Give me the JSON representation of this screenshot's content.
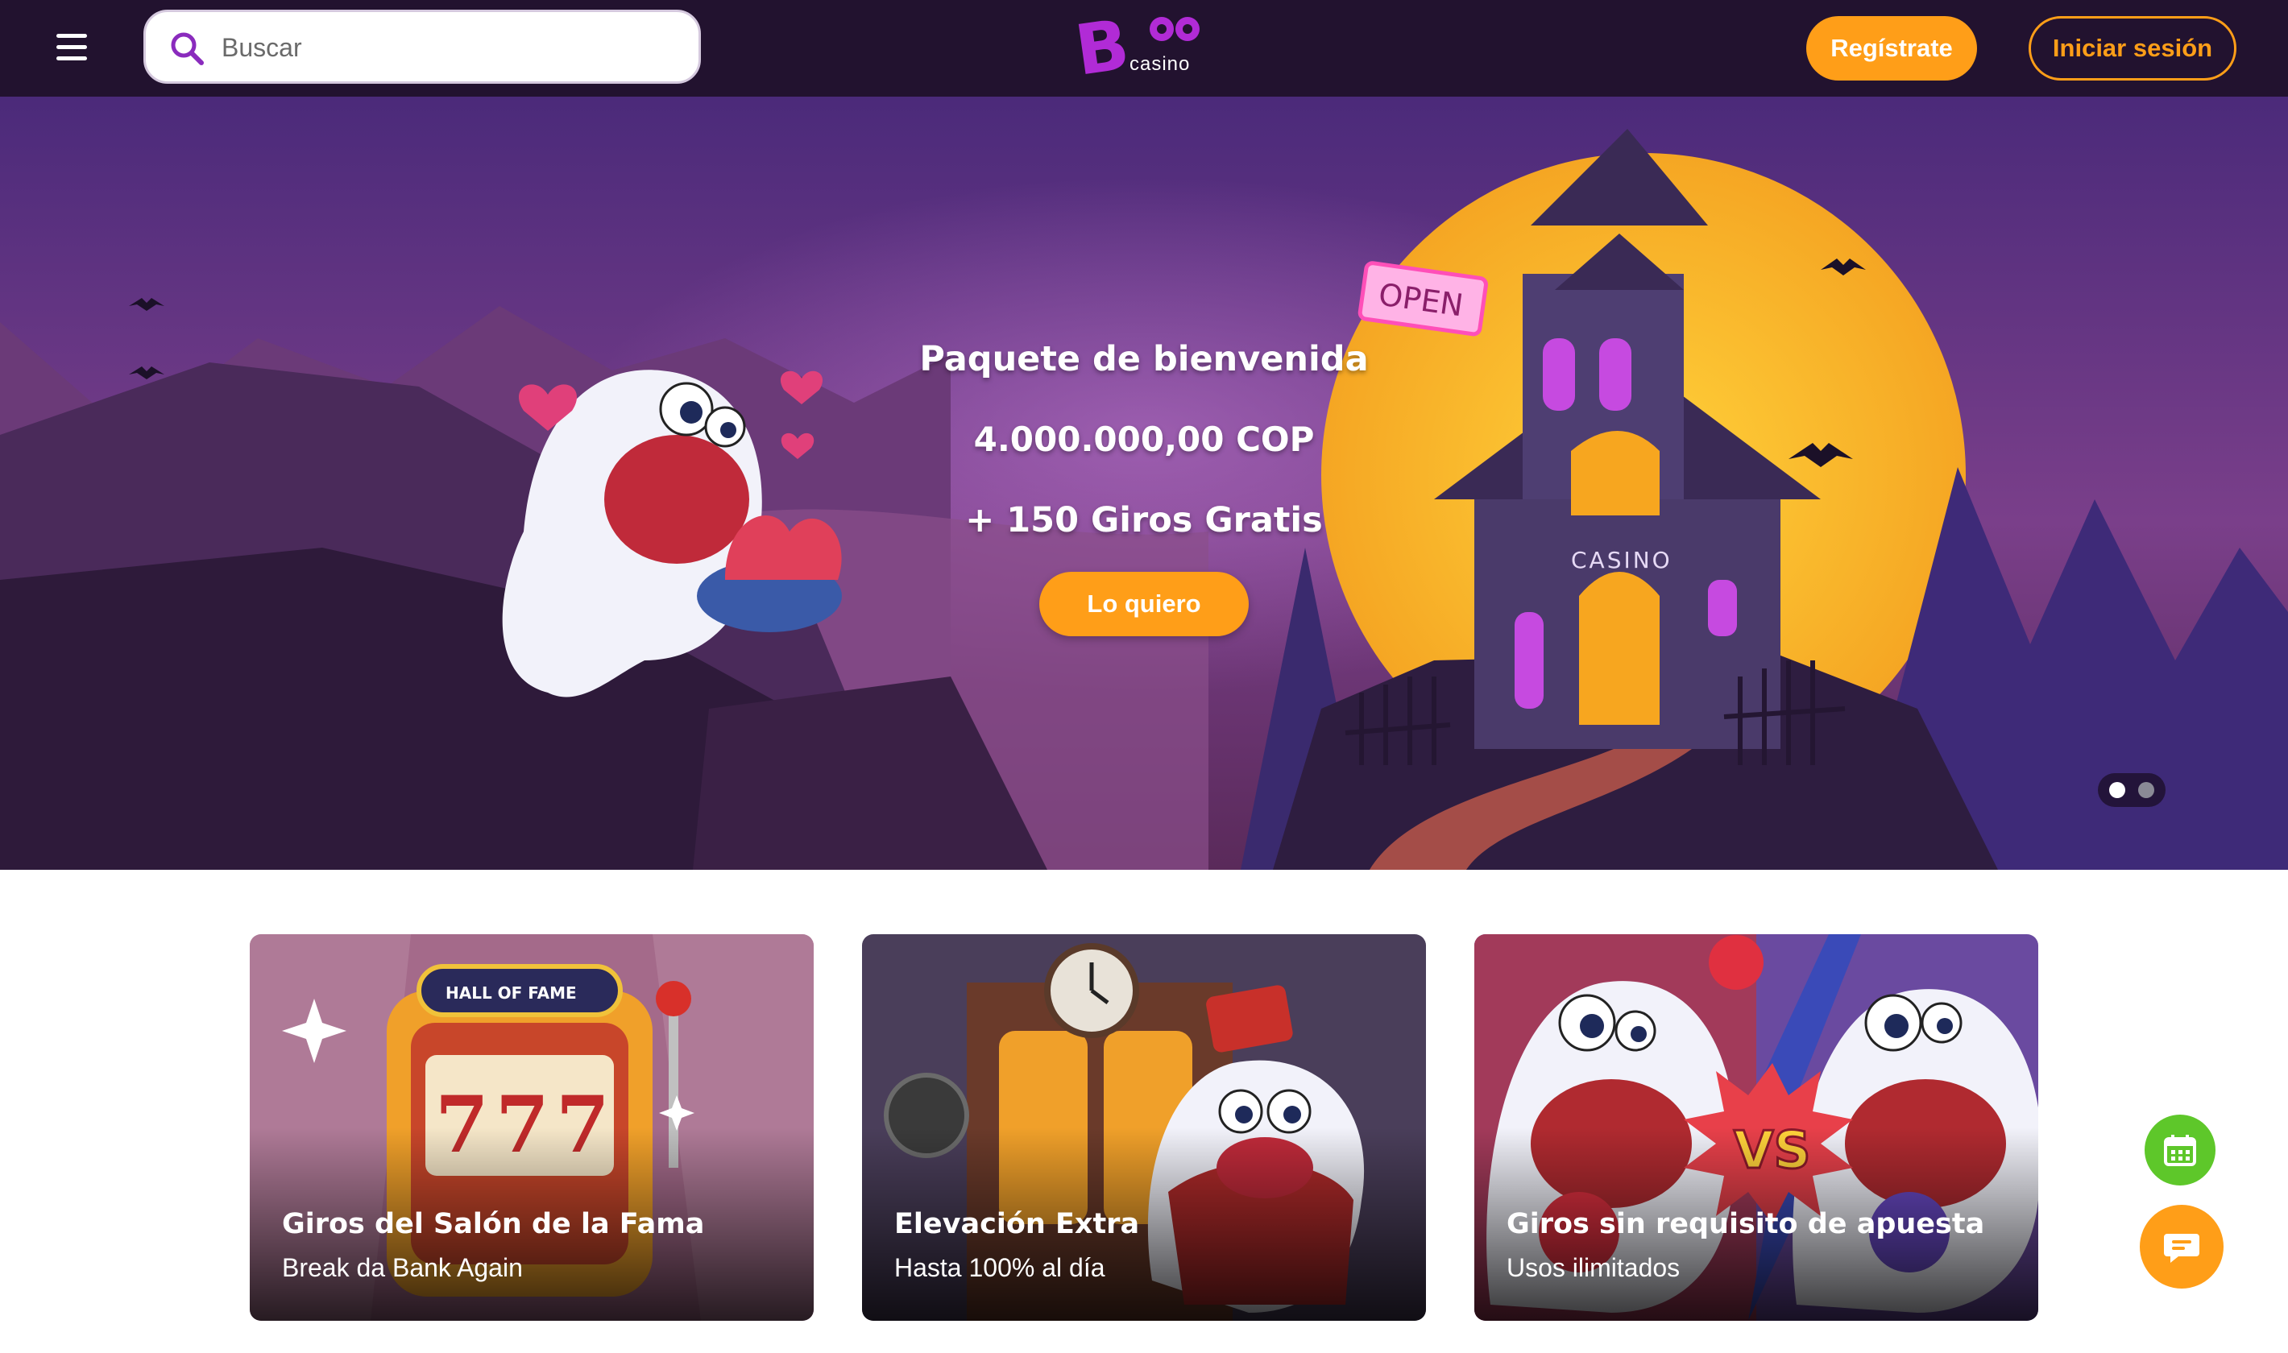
{
  "header": {
    "search_placeholder": "Buscar",
    "logo_text": "Boo",
    "logo_subtext": "casino",
    "register_label": "Regístrate",
    "login_label": "Iniciar sesión"
  },
  "hero": {
    "title": "Paquete de bienvenida",
    "amount": "4.000.000,00 COP",
    "spins": "+ 150 Giros Gratis",
    "cta_label": "Lo quiero",
    "sign_open": "OPEN",
    "sign_casino": "CASINO",
    "carousel_total": 2,
    "carousel_active": 1
  },
  "promos": [
    {
      "title": "Giros del Salón de la Fama",
      "subtitle": "Break da Bank Again",
      "badge": "HALL OF FAME",
      "reels": [
        "7",
        "7",
        "7"
      ]
    },
    {
      "title": "Elevación Extra",
      "subtitle": "Hasta 100% al día"
    },
    {
      "title": "Giros sin requisito de apuesta",
      "subtitle": "Usos ilimitados",
      "versus": "VS"
    }
  ],
  "colors": {
    "header_bg": "#22122f",
    "accent_orange": "#ff9e18",
    "logo_purple": "#b12bd6",
    "calendar_green": "#5ec72a"
  },
  "icons": {
    "menu": "hamburger-icon",
    "search": "search-icon",
    "calendar": "calendar-icon",
    "chat": "chat-icon"
  }
}
